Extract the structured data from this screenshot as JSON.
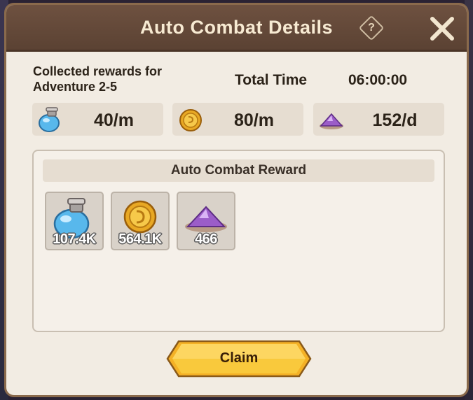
{
  "dialog": {
    "title": "Auto Combat Details",
    "help_glyph": "?"
  },
  "info": {
    "collected_label": "Collected rewards for Adventure 2-5",
    "total_time_label": "Total Time",
    "total_time_value": "06:00:00"
  },
  "rates": [
    {
      "icon": "potion-icon",
      "value": "40/m"
    },
    {
      "icon": "gold-coin-icon",
      "value": "80/m"
    },
    {
      "icon": "crystal-dust-icon",
      "value": "152/d"
    }
  ],
  "rewards": {
    "header": "Auto Combat Reward",
    "items": [
      {
        "icon": "potion-icon",
        "quantity": "107.4K"
      },
      {
        "icon": "gold-coin-icon",
        "quantity": "564.1K"
      },
      {
        "icon": "crystal-dust-icon",
        "quantity": "466"
      }
    ]
  },
  "actions": {
    "claim_label": "Claim"
  },
  "colors": {
    "title_bar": "#5b4233",
    "dialog_bg": "#f2ece3",
    "claim_button": "#f4b126",
    "potion_blue": "#58b8ec",
    "coin_gold": "#e8a824",
    "crystal_purple": "#9b5dc8"
  }
}
